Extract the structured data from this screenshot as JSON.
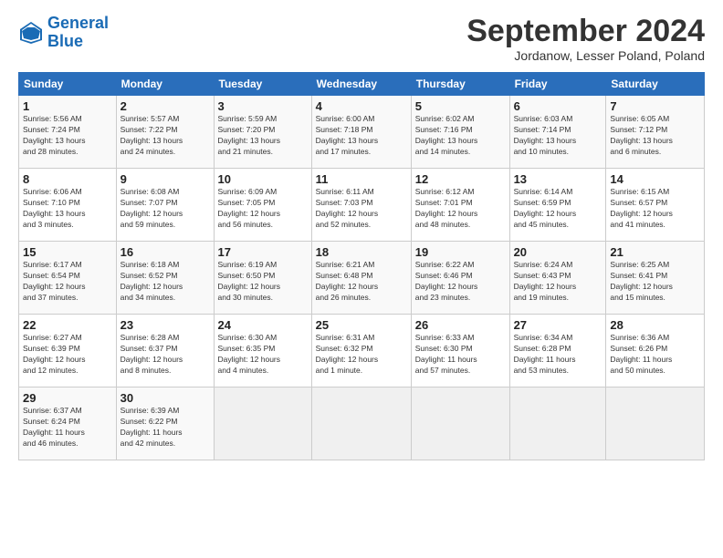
{
  "header": {
    "logo_line1": "General",
    "logo_line2": "Blue",
    "month_title": "September 2024",
    "subtitle": "Jordanow, Lesser Poland, Poland"
  },
  "weekdays": [
    "Sunday",
    "Monday",
    "Tuesday",
    "Wednesday",
    "Thursday",
    "Friday",
    "Saturday"
  ],
  "weeks": [
    [
      {
        "day": "1",
        "info": "Sunrise: 5:56 AM\nSunset: 7:24 PM\nDaylight: 13 hours\nand 28 minutes."
      },
      {
        "day": "2",
        "info": "Sunrise: 5:57 AM\nSunset: 7:22 PM\nDaylight: 13 hours\nand 24 minutes."
      },
      {
        "day": "3",
        "info": "Sunrise: 5:59 AM\nSunset: 7:20 PM\nDaylight: 13 hours\nand 21 minutes."
      },
      {
        "day": "4",
        "info": "Sunrise: 6:00 AM\nSunset: 7:18 PM\nDaylight: 13 hours\nand 17 minutes."
      },
      {
        "day": "5",
        "info": "Sunrise: 6:02 AM\nSunset: 7:16 PM\nDaylight: 13 hours\nand 14 minutes."
      },
      {
        "day": "6",
        "info": "Sunrise: 6:03 AM\nSunset: 7:14 PM\nDaylight: 13 hours\nand 10 minutes."
      },
      {
        "day": "7",
        "info": "Sunrise: 6:05 AM\nSunset: 7:12 PM\nDaylight: 13 hours\nand 6 minutes."
      }
    ],
    [
      {
        "day": "8",
        "info": "Sunrise: 6:06 AM\nSunset: 7:10 PM\nDaylight: 13 hours\nand 3 minutes."
      },
      {
        "day": "9",
        "info": "Sunrise: 6:08 AM\nSunset: 7:07 PM\nDaylight: 12 hours\nand 59 minutes."
      },
      {
        "day": "10",
        "info": "Sunrise: 6:09 AM\nSunset: 7:05 PM\nDaylight: 12 hours\nand 56 minutes."
      },
      {
        "day": "11",
        "info": "Sunrise: 6:11 AM\nSunset: 7:03 PM\nDaylight: 12 hours\nand 52 minutes."
      },
      {
        "day": "12",
        "info": "Sunrise: 6:12 AM\nSunset: 7:01 PM\nDaylight: 12 hours\nand 48 minutes."
      },
      {
        "day": "13",
        "info": "Sunrise: 6:14 AM\nSunset: 6:59 PM\nDaylight: 12 hours\nand 45 minutes."
      },
      {
        "day": "14",
        "info": "Sunrise: 6:15 AM\nSunset: 6:57 PM\nDaylight: 12 hours\nand 41 minutes."
      }
    ],
    [
      {
        "day": "15",
        "info": "Sunrise: 6:17 AM\nSunset: 6:54 PM\nDaylight: 12 hours\nand 37 minutes."
      },
      {
        "day": "16",
        "info": "Sunrise: 6:18 AM\nSunset: 6:52 PM\nDaylight: 12 hours\nand 34 minutes."
      },
      {
        "day": "17",
        "info": "Sunrise: 6:19 AM\nSunset: 6:50 PM\nDaylight: 12 hours\nand 30 minutes."
      },
      {
        "day": "18",
        "info": "Sunrise: 6:21 AM\nSunset: 6:48 PM\nDaylight: 12 hours\nand 26 minutes."
      },
      {
        "day": "19",
        "info": "Sunrise: 6:22 AM\nSunset: 6:46 PM\nDaylight: 12 hours\nand 23 minutes."
      },
      {
        "day": "20",
        "info": "Sunrise: 6:24 AM\nSunset: 6:43 PM\nDaylight: 12 hours\nand 19 minutes."
      },
      {
        "day": "21",
        "info": "Sunrise: 6:25 AM\nSunset: 6:41 PM\nDaylight: 12 hours\nand 15 minutes."
      }
    ],
    [
      {
        "day": "22",
        "info": "Sunrise: 6:27 AM\nSunset: 6:39 PM\nDaylight: 12 hours\nand 12 minutes."
      },
      {
        "day": "23",
        "info": "Sunrise: 6:28 AM\nSunset: 6:37 PM\nDaylight: 12 hours\nand 8 minutes."
      },
      {
        "day": "24",
        "info": "Sunrise: 6:30 AM\nSunset: 6:35 PM\nDaylight: 12 hours\nand 4 minutes."
      },
      {
        "day": "25",
        "info": "Sunrise: 6:31 AM\nSunset: 6:32 PM\nDaylight: 12 hours\nand 1 minute."
      },
      {
        "day": "26",
        "info": "Sunrise: 6:33 AM\nSunset: 6:30 PM\nDaylight: 11 hours\nand 57 minutes."
      },
      {
        "day": "27",
        "info": "Sunrise: 6:34 AM\nSunset: 6:28 PM\nDaylight: 11 hours\nand 53 minutes."
      },
      {
        "day": "28",
        "info": "Sunrise: 6:36 AM\nSunset: 6:26 PM\nDaylight: 11 hours\nand 50 minutes."
      }
    ],
    [
      {
        "day": "29",
        "info": "Sunrise: 6:37 AM\nSunset: 6:24 PM\nDaylight: 11 hours\nand 46 minutes."
      },
      {
        "day": "30",
        "info": "Sunrise: 6:39 AM\nSunset: 6:22 PM\nDaylight: 11 hours\nand 42 minutes."
      },
      {
        "day": "",
        "info": ""
      },
      {
        "day": "",
        "info": ""
      },
      {
        "day": "",
        "info": ""
      },
      {
        "day": "",
        "info": ""
      },
      {
        "day": "",
        "info": ""
      }
    ]
  ]
}
